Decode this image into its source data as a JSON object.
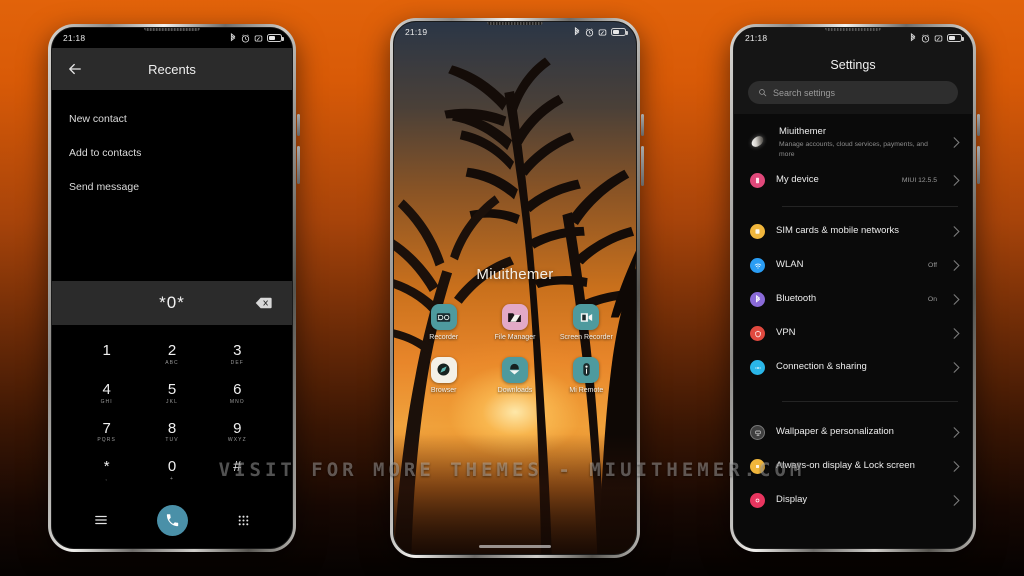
{
  "background": {
    "top_color": "#e2630a",
    "bottom_color": "#050201"
  },
  "watermark": {
    "text": "VISIT FOR MORE THEMES - MIUITHEMER.COM"
  },
  "phone_dialer": {
    "status_bar": {
      "time": "21:18",
      "icons": [
        "bluetooth-icon",
        "alarm-icon",
        "vibrate-icon",
        "battery-icon"
      ]
    },
    "app_bar": {
      "back_label": "back-arrow",
      "title": "Recents"
    },
    "menu_items": [
      {
        "label": "New contact"
      },
      {
        "label": "Add to contacts"
      },
      {
        "label": "Send message"
      }
    ],
    "number_field": {
      "value": "*0*",
      "delete_label": "backspace"
    },
    "keypad": [
      {
        "digit": "1",
        "letters": "⁠"
      },
      {
        "digit": "2",
        "letters": "ABC"
      },
      {
        "digit": "3",
        "letters": "DEF"
      },
      {
        "digit": "4",
        "letters": "GHI"
      },
      {
        "digit": "5",
        "letters": "JKL"
      },
      {
        "digit": "6",
        "letters": "MNO"
      },
      {
        "digit": "7",
        "letters": "PQRS"
      },
      {
        "digit": "8",
        "letters": "TUV"
      },
      {
        "digit": "9",
        "letters": "WXYZ"
      },
      {
        "digit": "*",
        "letters": ","
      },
      {
        "digit": "0",
        "letters": "+"
      },
      {
        "digit": "#",
        "letters": ""
      }
    ],
    "bottom_bar": {
      "menu_label": "menu-icon",
      "call_label": "call-icon",
      "call_color": "#4a90a8",
      "keypad_label": "dialpad-icon"
    }
  },
  "phone_home": {
    "status_bar": {
      "time": "21:19",
      "icons": [
        "bluetooth-icon",
        "alarm-icon",
        "vibrate-icon",
        "battery-icon"
      ]
    },
    "wallpaper_label": "Miuithemer",
    "apps": [
      {
        "name": "Recorder",
        "bg": "#4e9a9e",
        "icon": "recorder-icon"
      },
      {
        "name": "File Manager",
        "bg": "#e2a8c4",
        "icon": "folder-icon"
      },
      {
        "name": "Screen Recorder",
        "bg": "#4e9a9e",
        "icon": "screen-recorder-icon"
      },
      {
        "name": "Browser",
        "bg": "#f2efe6",
        "icon": "compass-icon"
      },
      {
        "name": "Downloads",
        "bg": "#4e9a9e",
        "icon": "download-icon"
      },
      {
        "name": "Mi Remote",
        "bg": "#4e9a9e",
        "icon": "remote-icon"
      }
    ]
  },
  "phone_settings": {
    "status_bar": {
      "time": "21:18",
      "icons": [
        "bluetooth-icon",
        "alarm-icon",
        "vibrate-icon",
        "battery-icon"
      ]
    },
    "title": "Settings",
    "search": {
      "placeholder": "Search settings",
      "icon": "search-icon"
    },
    "groups": [
      {
        "rows": [
          {
            "title": "Miuithemer",
            "subtitle": "Manage accounts, cloud services, payments, and more",
            "value": "",
            "icon": "account-avatar",
            "color": ""
          },
          {
            "title": "My device",
            "subtitle": "",
            "value": "MIUI 12.5.5",
            "icon": "device-icon",
            "color": "#e0487a"
          }
        ]
      },
      {
        "rows": [
          {
            "title": "SIM cards & mobile networks",
            "subtitle": "",
            "value": "",
            "icon": "sim-icon",
            "color": "#f0b63c"
          },
          {
            "title": "WLAN",
            "subtitle": "",
            "value": "Off",
            "icon": "wifi-icon",
            "color": "#2a9df4"
          },
          {
            "title": "Bluetooth",
            "subtitle": "",
            "value": "On",
            "icon": "bluetooth-icon",
            "color": "#8a6ad8"
          },
          {
            "title": "VPN",
            "subtitle": "",
            "value": "",
            "icon": "vpn-icon",
            "color": "#e0493f"
          },
          {
            "title": "Connection & sharing",
            "subtitle": "",
            "value": "",
            "icon": "sharing-icon",
            "color": "#2ab6e8"
          }
        ]
      },
      {
        "rows": [
          {
            "title": "Wallpaper & personalization",
            "subtitle": "",
            "value": "",
            "icon": "wallpaper-icon",
            "color": "#4a4a4a"
          },
          {
            "title": "Always-on display & Lock screen",
            "subtitle": "",
            "value": "",
            "icon": "aod-icon",
            "color": "#f0b63c"
          },
          {
            "title": "Display",
            "subtitle": "",
            "value": "",
            "icon": "display-icon",
            "color": "#e8355f"
          }
        ]
      }
    ]
  }
}
